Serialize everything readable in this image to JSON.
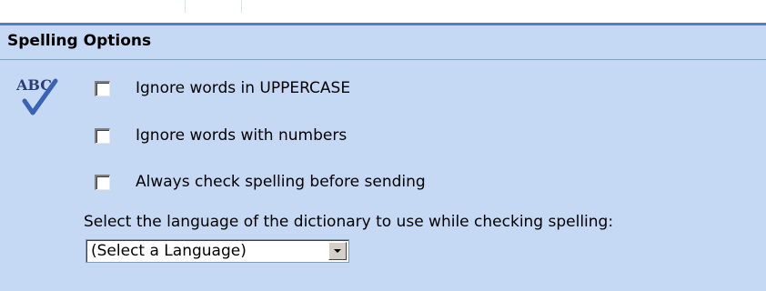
{
  "section": {
    "title": "Spelling Options"
  },
  "icon": {
    "name": "abc-check-icon",
    "text": "ABC",
    "text_color": "#2b3f77",
    "check_color": "#3a63b4"
  },
  "options": [
    {
      "label": "Ignore words in UPPERCASE",
      "checked": false
    },
    {
      "label": "Ignore words with numbers",
      "checked": false
    },
    {
      "label": "Always check spelling before sending",
      "checked": false
    }
  ],
  "language": {
    "instruction": "Select the language of the dictionary to use while checking spelling:",
    "selected": "(Select a Language)"
  },
  "colors": {
    "panel_bg": "#c5d9f4",
    "header_divider": "#4f7fc4"
  }
}
